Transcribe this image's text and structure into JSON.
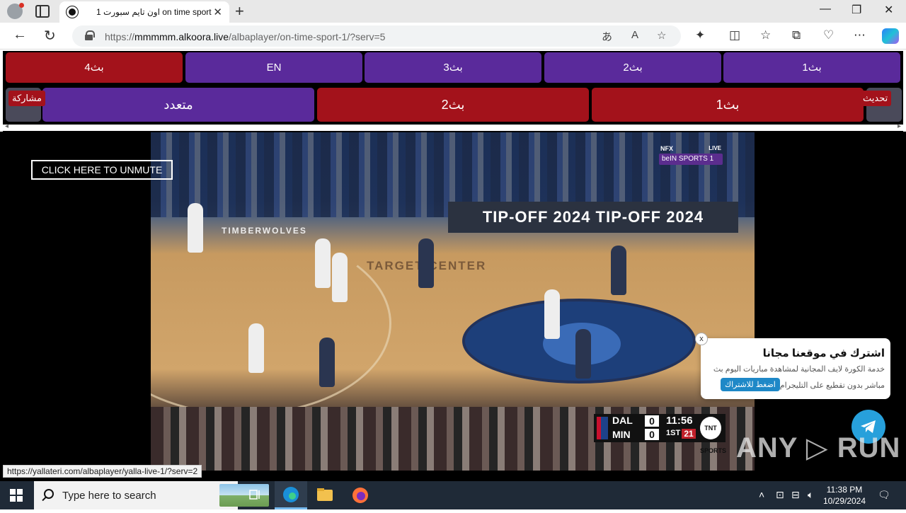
{
  "browser": {
    "tab_title": "اون تايم سبورت 1 on time sport",
    "tab_close": "✕",
    "new_tab": "+",
    "url_prefix": "https://",
    "url_domain": "mmmmm.alkoora.live",
    "url_path": "/albaplayer/on-time-sport-1/?serv=5",
    "window_controls": [
      "—",
      "❐",
      "✕"
    ],
    "nav": {
      "back": "←",
      "reload": "↻"
    },
    "address_icons": [
      "あ",
      "A",
      "☆"
    ],
    "toolbar_icons": [
      "✦",
      "◫",
      "☆",
      "⧉",
      "♡",
      "⋯"
    ]
  },
  "page": {
    "row1_buttons": [
      {
        "label": "بث4",
        "color": "#a3121b"
      },
      {
        "label": "EN",
        "color": "#5a2a9b"
      },
      {
        "label": "بث3",
        "color": "#5a2a9b"
      },
      {
        "label": "بث2",
        "color": "#5a2a9b"
      },
      {
        "label": "بث1",
        "color": "#5a2a9b"
      }
    ],
    "row2_buttons": [
      {
        "label": "متعدد",
        "color": "#5a2a9b"
      },
      {
        "label": "بث2",
        "color": "#a3121b"
      },
      {
        "label": "بث1",
        "color": "#a3121b"
      }
    ],
    "share_label": "مشاركة",
    "refresh_label": "تحديث",
    "scroll_left": "◂",
    "scroll_right": "▸",
    "unmute_label": "CLICK HERE TO UNMUTE",
    "video": {
      "ad_board": "TIP-OFF 2024   TIP-OFF 2024",
      "arena_text": "TARGET CENTER",
      "team_banner": "TIMBERWOLVES",
      "channel": {
        "nfx": "NFX",
        "live": "LIVE",
        "name": "beIN SPORTS 1"
      },
      "scoreboard": {
        "team1": "DAL",
        "score1": "0",
        "team2": "MIN",
        "score2": "0",
        "clock": "11:56",
        "period": "1ST",
        "shot_clock": "21",
        "network": "TNT SPORTS"
      }
    },
    "popup": {
      "title": "اشترك في موقعنا مجانا",
      "line1": "خدمة الكورة لايف المجانية لمشاهدة مباريات اليوم بث",
      "line2": "مباشر بدون تقطيع على التليجرام",
      "button": "اضغط للاشتراك",
      "close": "x"
    },
    "watermark": "ANY ▷ RUN",
    "status_url": "https://yallateri.com/albaplayer/yalla-live-1/?serv=2"
  },
  "taskbar": {
    "search_placeholder": "Type here to search",
    "time": "11:38 PM",
    "date": "10/29/2024"
  },
  "colors": {
    "purple": "#5a2a9b",
    "red": "#a3121b",
    "telegram": "#27a0db",
    "taskbar": "#1f2a37"
  }
}
